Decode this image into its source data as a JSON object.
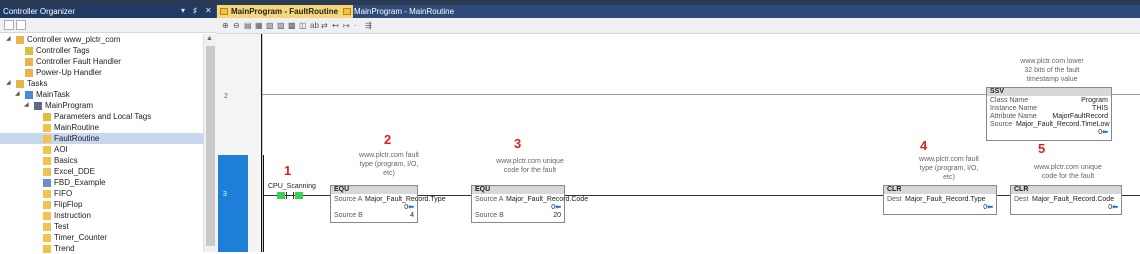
{
  "organizer": {
    "title": "Controller Organizer",
    "header_controls": [
      "▾",
      "♯",
      "✕"
    ],
    "tree": [
      {
        "label": "Controller www_plctr_com",
        "icon": "folder-icon",
        "expander": "◢",
        "level": 0
      },
      {
        "label": "Controller Tags",
        "icon": "tag-icon",
        "expander": "",
        "level": 1
      },
      {
        "label": "Controller Fault Handler",
        "icon": "folder-icon",
        "expander": "",
        "level": 1
      },
      {
        "label": "Power-Up Handler",
        "icon": "folder-icon",
        "expander": "",
        "level": 1
      },
      {
        "label": "Tasks",
        "icon": "folder-icon",
        "expander": "◢",
        "level": 0
      },
      {
        "label": "MainTask",
        "icon": "task-icon",
        "expander": "◢",
        "level": 1
      },
      {
        "label": "MainProgram",
        "icon": "program-icon",
        "expander": "◢",
        "level": 2
      },
      {
        "label": "Parameters and Local Tags",
        "icon": "tag-icon",
        "expander": "",
        "level": 3
      },
      {
        "label": "MainRoutine",
        "icon": "routine-icon",
        "expander": "",
        "level": 3
      },
      {
        "label": "FaultRoutine",
        "icon": "routine-icon",
        "expander": "",
        "level": 3,
        "selected": true
      },
      {
        "label": "AOI",
        "icon": "routine-icon",
        "expander": "",
        "level": 3
      },
      {
        "label": "Basics",
        "icon": "routine-icon",
        "expander": "",
        "level": 3
      },
      {
        "label": "Excel_DDE",
        "icon": "routine-icon",
        "expander": "",
        "level": 3
      },
      {
        "label": "FBD_Example",
        "icon": "fbd-icon",
        "expander": "",
        "level": 3
      },
      {
        "label": "FIFO",
        "icon": "routine-icon",
        "expander": "",
        "level": 3
      },
      {
        "label": "FlipFlop",
        "icon": "routine-icon",
        "expander": "",
        "level": 3
      },
      {
        "label": "Instruction",
        "icon": "routine-icon",
        "expander": "",
        "level": 3
      },
      {
        "label": "Test",
        "icon": "routine-icon",
        "expander": "",
        "level": 3
      },
      {
        "label": "Timer_Counter",
        "icon": "routine-icon",
        "expander": "",
        "level": 3
      },
      {
        "label": "Trend",
        "icon": "routine-icon",
        "expander": "",
        "level": 3
      }
    ]
  },
  "editor": {
    "tabs": [
      {
        "label": "MainProgram - FaultRoutine",
        "close": "×",
        "active": true
      },
      {
        "label": "MainProgram - MainRoutine",
        "active": false
      }
    ],
    "toolbar": [
      "⊕",
      "⊖",
      "▤",
      "▦",
      "▧",
      "▨",
      "▩",
      "◫",
      "ab",
      "⇄",
      "↤",
      "↦",
      "·",
      "⇶"
    ]
  },
  "rungs": {
    "rung2": {
      "number": "2"
    },
    "rung3": {
      "number": "3"
    }
  },
  "ssv": {
    "desc": [
      "www.plctr.com lower",
      "32 bits of the fault",
      "timestamp value"
    ],
    "header": "SSV",
    "rows": [
      {
        "key": "Class Name",
        "value": "Program"
      },
      {
        "key": "Instance Name",
        "value": "THIS"
      },
      {
        "key": "Attribute Name",
        "value": "MajorFaultRecord"
      },
      {
        "key": "Source",
        "value": "Major_Fault_Record.TimeLow"
      }
    ],
    "out": "0"
  },
  "contact": {
    "tag": "CPU_Scanning",
    "callout": "1"
  },
  "equ1": {
    "callout": "2",
    "desc": [
      "www.plctr.com fault",
      "type (program, I/O,",
      "etc)"
    ],
    "header": "EQU",
    "srcA_label": "Source A",
    "srcA_tag": "Major_Fault_Record.Type",
    "srcA_val": "0",
    "srcB_label": "Source B",
    "srcB_val": "4"
  },
  "equ2": {
    "callout": "3",
    "desc": [
      "www.plctr.com unique",
      "code for the fault"
    ],
    "header": "EQU",
    "srcA_label": "Source A",
    "srcA_tag": "Major_Fault_Record.Code",
    "srcA_val": "0",
    "srcB_label": "Source B",
    "srcB_val": "20"
  },
  "clr1": {
    "callout": "4",
    "desc": [
      "www.plctr.com fault",
      "type (program, I/O,",
      "etc)"
    ],
    "header": "CLR",
    "dest_label": "Dest",
    "dest_tag": "Major_Fault_Record.Type",
    "dest_val": "0"
  },
  "clr2": {
    "callout": "5",
    "desc": [
      "www.plctr.com unique",
      "code for the fault"
    ],
    "header": "CLR",
    "dest_label": "Dest",
    "dest_tag": "Major_Fault_Record.Code",
    "dest_val": "0"
  },
  "colors": {
    "accent": "#1e7fd8",
    "callout": "#e02020",
    "value_arrow": "#1e6fd1",
    "contact_on": "#3ad15a"
  }
}
